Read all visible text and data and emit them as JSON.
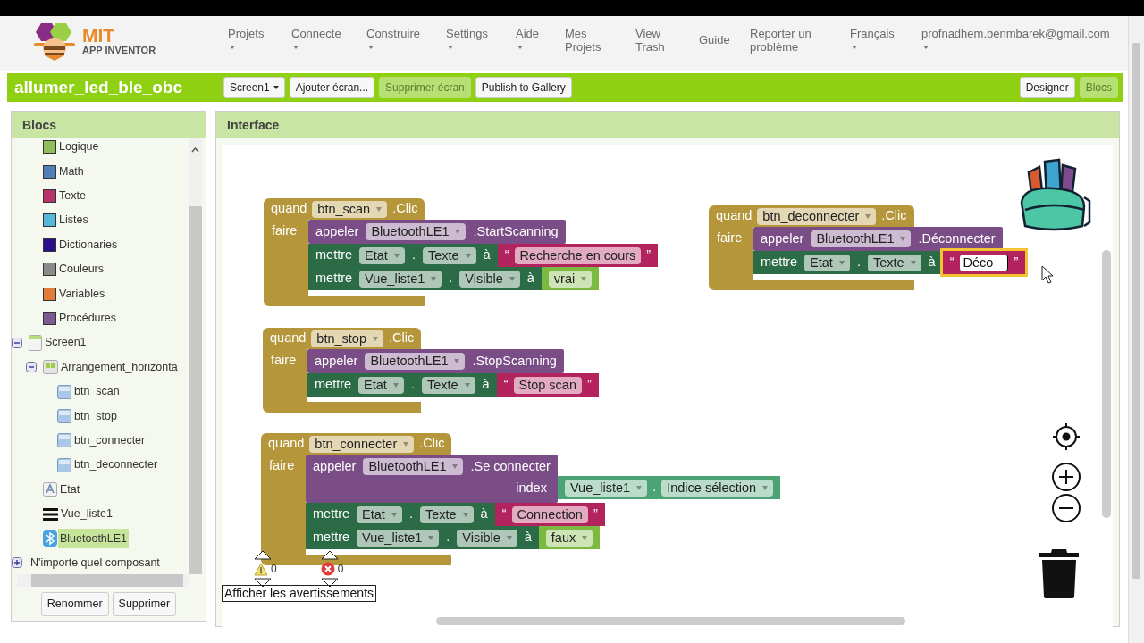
{
  "header": {
    "logo": {
      "title": "MIT",
      "subtitle": "APP INVENTOR"
    },
    "menu": [
      {
        "label": "Projets",
        "dropdown": true
      },
      {
        "label": "Connecte",
        "dropdown": true
      },
      {
        "label": "Construire",
        "dropdown": true
      },
      {
        "label": "Settings",
        "dropdown": true
      },
      {
        "label": "Aide",
        "dropdown": true
      },
      {
        "label": "Mes Projets",
        "dropdown": false
      },
      {
        "label": "View Trash",
        "dropdown": false
      },
      {
        "label": "Guide",
        "dropdown": false
      },
      {
        "label": "Reporter un problème",
        "dropdown": false
      },
      {
        "label": "Français",
        "dropdown": true
      },
      {
        "label": "profnadhem.benmbarek@gmail.com",
        "dropdown": true
      }
    ]
  },
  "project_bar": {
    "title": "allumer_led_ble_obc",
    "buttons": [
      {
        "label": "Screen1",
        "kind": "dropdown",
        "disabled": false
      },
      {
        "label": "Ajouter écran...",
        "kind": "button",
        "disabled": false
      },
      {
        "label": "Supprimer écran",
        "kind": "button",
        "disabled": true
      },
      {
        "label": "Publish to Gallery",
        "kind": "button",
        "disabled": false
      }
    ],
    "views": [
      {
        "label": "Designer",
        "selected": false
      },
      {
        "label": "Blocs",
        "selected": true
      }
    ]
  },
  "blocks_panel": {
    "title": "Blocs",
    "tree": [
      {
        "label": "Logique",
        "kind": "builtin",
        "color": "#8fbf5a",
        "selected": false
      },
      {
        "label": "Math",
        "kind": "builtin",
        "color": "#4f7fb6",
        "selected": false
      },
      {
        "label": "Texte",
        "kind": "builtin",
        "color": "#b8336a",
        "selected": false
      },
      {
        "label": "Listes",
        "kind": "builtin",
        "color": "#53b9d6",
        "selected": false
      },
      {
        "label": "Dictionaries",
        "kind": "builtin",
        "color": "#2a0f8a",
        "selected": false
      },
      {
        "label": "Couleurs",
        "kind": "builtin",
        "color": "#8a8a8a",
        "selected": false
      },
      {
        "label": "Variables",
        "kind": "builtin",
        "color": "#e07b3a",
        "selected": false
      },
      {
        "label": "Procédures",
        "kind": "builtin",
        "color": "#7d5a8f",
        "selected": false
      },
      {
        "label": "Screen1",
        "kind": "screen",
        "expanded": true,
        "selected": false,
        "children": [
          {
            "label": "Arrangement_horizonta",
            "kind": "arrangement",
            "expanded": true,
            "selected": false,
            "children": [
              {
                "label": "btn_scan",
                "kind": "button",
                "selected": false
              },
              {
                "label": "btn_stop",
                "kind": "button",
                "selected": false
              },
              {
                "label": "btn_connecter",
                "kind": "button",
                "selected": false
              },
              {
                "label": "btn_deconnecter",
                "kind": "button",
                "selected": false
              }
            ]
          },
          {
            "label": "Etat",
            "kind": "label",
            "selected": false
          },
          {
            "label": "Vue_liste1",
            "kind": "listview",
            "selected": false
          },
          {
            "label": "BluetoothLE1",
            "kind": "bluetooth",
            "selected": true
          }
        ]
      },
      {
        "label": "N'importe quel composant",
        "kind": "any",
        "expanded": false,
        "selected": false
      }
    ],
    "buttons": [
      "Renommer",
      "Supprimer"
    ]
  },
  "workspace": {
    "title": "Interface",
    "scripts": [
      {
        "event_word": "quand",
        "component": "btn_scan",
        "event": ".Clic",
        "do_word": "faire",
        "statements": [
          {
            "kind": "call",
            "word": "appeler",
            "component": "BluetoothLE1",
            "method": ".StartScanning"
          },
          {
            "kind": "set",
            "word": "mettre",
            "component": "Etat",
            "dot": ".",
            "property": "Texte",
            "to": "à",
            "value": {
              "kind": "text",
              "open": "“",
              "text": "Recherche en cours",
              "close": "”",
              "editing": false
            }
          },
          {
            "kind": "set",
            "word": "mettre",
            "component": "Vue_liste1",
            "dot": ".",
            "property": "Visible",
            "to": "à",
            "value": {
              "kind": "logic",
              "text": "vrai"
            }
          }
        ]
      },
      {
        "event_word": "quand",
        "component": "btn_deconnecter",
        "event": ".Clic",
        "do_word": "faire",
        "statements": [
          {
            "kind": "call",
            "word": "appeler",
            "component": "BluetoothLE1",
            "method": ".Déconnecter"
          },
          {
            "kind": "set",
            "word": "mettre",
            "component": "Etat",
            "dot": ".",
            "property": "Texte",
            "to": "à",
            "value": {
              "kind": "text",
              "open": "“",
              "text": "Déco",
              "close": "”",
              "editing": true
            }
          }
        ]
      },
      {
        "event_word": "quand",
        "component": "btn_stop",
        "event": ".Clic",
        "do_word": "faire",
        "statements": [
          {
            "kind": "call",
            "word": "appeler",
            "component": "BluetoothLE1",
            "method": ".StopScanning"
          },
          {
            "kind": "set",
            "word": "mettre",
            "component": "Etat",
            "dot": ".",
            "property": "Texte",
            "to": "à",
            "value": {
              "kind": "text",
              "open": "“",
              "text": "Stop scan",
              "close": "”",
              "editing": false
            }
          }
        ]
      },
      {
        "event_word": "quand",
        "component": "btn_connecter",
        "event": ".Clic",
        "do_word": "faire",
        "statements": [
          {
            "kind": "call",
            "word": "appeler",
            "component": "BluetoothLE1",
            "method": ".Se connecter",
            "args": [
              {
                "label": "index",
                "value": {
                  "kind": "getter",
                  "component": "Vue_liste1",
                  "dot": ".",
                  "property": "Indice sélection"
                }
              }
            ]
          },
          {
            "kind": "set",
            "word": "mettre",
            "component": "Etat",
            "dot": ".",
            "property": "Texte",
            "to": "à",
            "value": {
              "kind": "text",
              "open": "“",
              "text": "Connection",
              "close": "”",
              "editing": false
            }
          },
          {
            "kind": "set",
            "word": "mettre",
            "component": "Vue_liste1",
            "dot": ".",
            "property": "Visible",
            "to": "à",
            "value": {
              "kind": "logic",
              "text": "faux"
            }
          }
        ]
      }
    ],
    "warnings": {
      "warning_count": "0",
      "error_count": "0",
      "toggle_label": "Afficher les avertissements"
    }
  }
}
